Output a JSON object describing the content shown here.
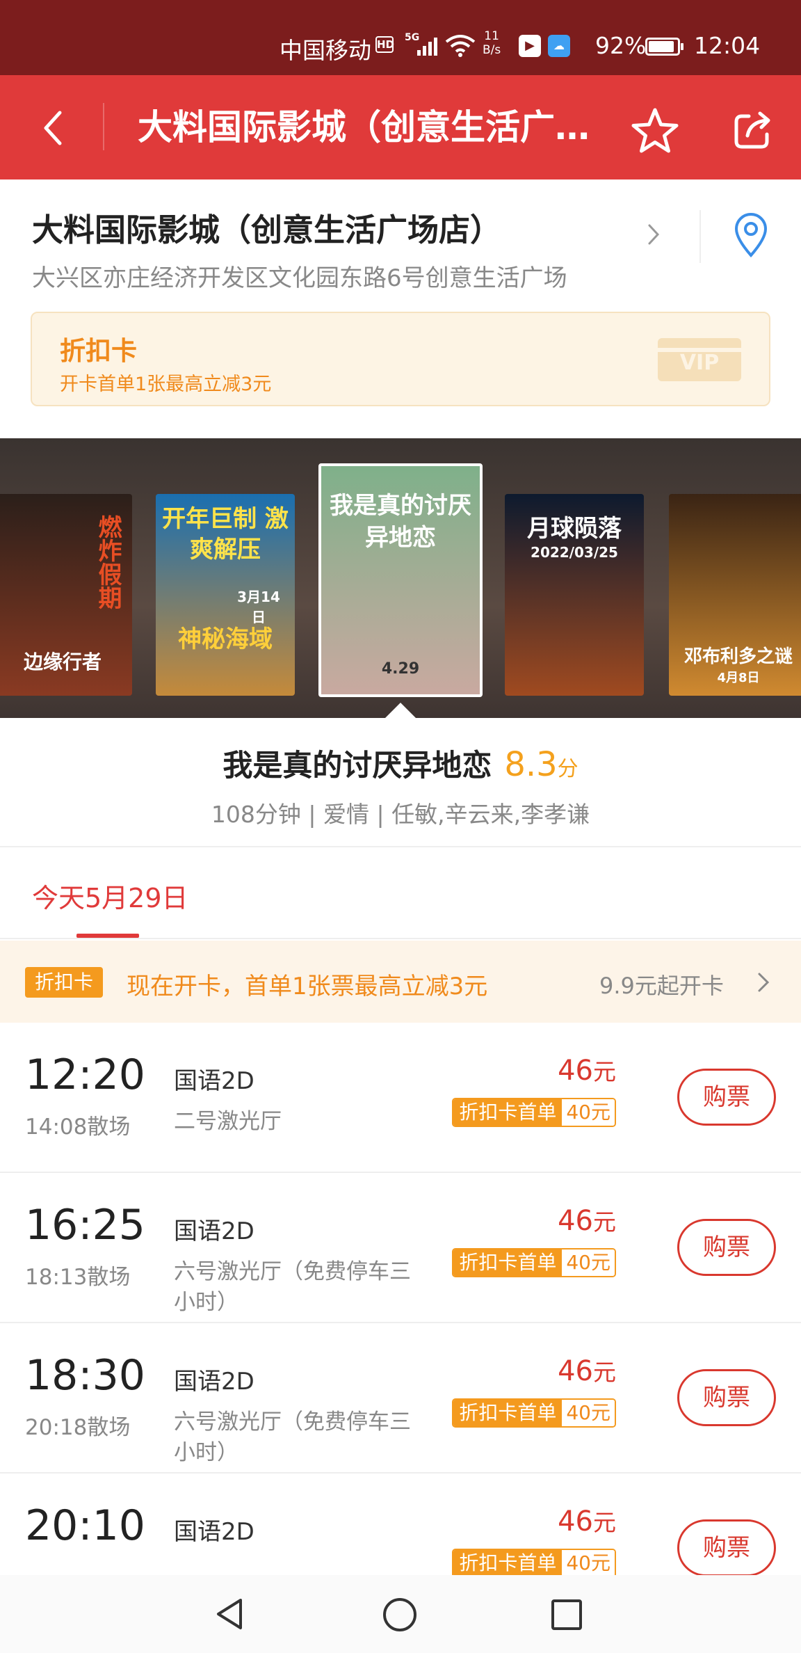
{
  "status_bar": {
    "carrier": "中国移动",
    "hd": "HD",
    "network": "5G",
    "speed_value": "11",
    "speed_unit": "B/s",
    "battery_pct": "92%",
    "battery_level": 0.92,
    "time": "12:04"
  },
  "header": {
    "title": "大料国际影城（创意生活广场店）",
    "back_icon": "chevron-left-icon",
    "star_icon": "star-icon",
    "share_icon": "share-icon"
  },
  "cinema": {
    "name": "大料国际影城（创意生活广场店）",
    "address": "大兴区亦庄经济开发区文化园东路6号创意生活广场",
    "card": {
      "title": "折扣卡",
      "subtitle": "开卡首单1张最高立减3元",
      "badge": "VIP"
    }
  },
  "posters": [
    {
      "title": "边缘行者",
      "tag": "燃炸假期",
      "colors": [
        "#2b1f1a",
        "#8a3a22"
      ]
    },
    {
      "title": "神秘海域",
      "tag": "开年巨制 激爽解压",
      "date": "3月14日",
      "colors": [
        "#1a6fb0",
        "#c58a3a"
      ]
    },
    {
      "title": "我是真的讨厌异地恋",
      "date": "4.29",
      "colors": [
        "#7fb08a",
        "#c9a9a0"
      ]
    },
    {
      "title": "月球陨落",
      "date": "2022/03/25",
      "colors": [
        "#0d1a2e",
        "#a04a20"
      ]
    },
    {
      "title": "邓布利多之谜",
      "date": "4月8日",
      "colors": [
        "#3a2414",
        "#d08a30"
      ]
    }
  ],
  "movie": {
    "title": "我是真的讨厌异地恋",
    "score": "8.3",
    "score_unit": "分",
    "meta": "108分钟 | 爱情 | 任敏,辛云来,李孝谦"
  },
  "date_tab": {
    "label": "今天5月29日"
  },
  "promo": {
    "badge": "折扣卡",
    "text": "现在开卡，首单1张票最高立减3元",
    "right": "9.9元起开卡"
  },
  "showtimes": [
    {
      "start": "12:20",
      "end": "14:08散场",
      "lang": "国语2D",
      "hall": "二号激光厅",
      "price": "46",
      "price_unit": "元",
      "disc_label": "折扣卡首单",
      "disc_price": "40元",
      "buy": "购票"
    },
    {
      "start": "16:25",
      "end": "18:13散场",
      "lang": "国语2D",
      "hall": "六号激光厅（免费停车三小时）",
      "price": "46",
      "price_unit": "元",
      "disc_label": "折扣卡首单",
      "disc_price": "40元",
      "buy": "购票"
    },
    {
      "start": "18:30",
      "end": "20:18散场",
      "lang": "国语2D",
      "hall": "六号激光厅（免费停车三小时）",
      "price": "46",
      "price_unit": "元",
      "disc_label": "折扣卡首单",
      "disc_price": "40元",
      "buy": "购票"
    },
    {
      "start": "20:10",
      "end": "",
      "lang": "国语2D",
      "hall": "",
      "price": "46",
      "price_unit": "元",
      "disc_label": "折扣卡首单",
      "disc_price": "40元",
      "buy": "购票"
    }
  ],
  "nav": {
    "back_icon": "triangle-back-icon",
    "home_icon": "circle-home-icon",
    "recent_icon": "square-recents-icon"
  },
  "colors": {
    "status_bg": "#7c1d1d",
    "header_bg": "#e03a3a",
    "accent_orange": "#f49a1e",
    "price_red": "#d9382e",
    "score_orange": "#f4a11d"
  }
}
